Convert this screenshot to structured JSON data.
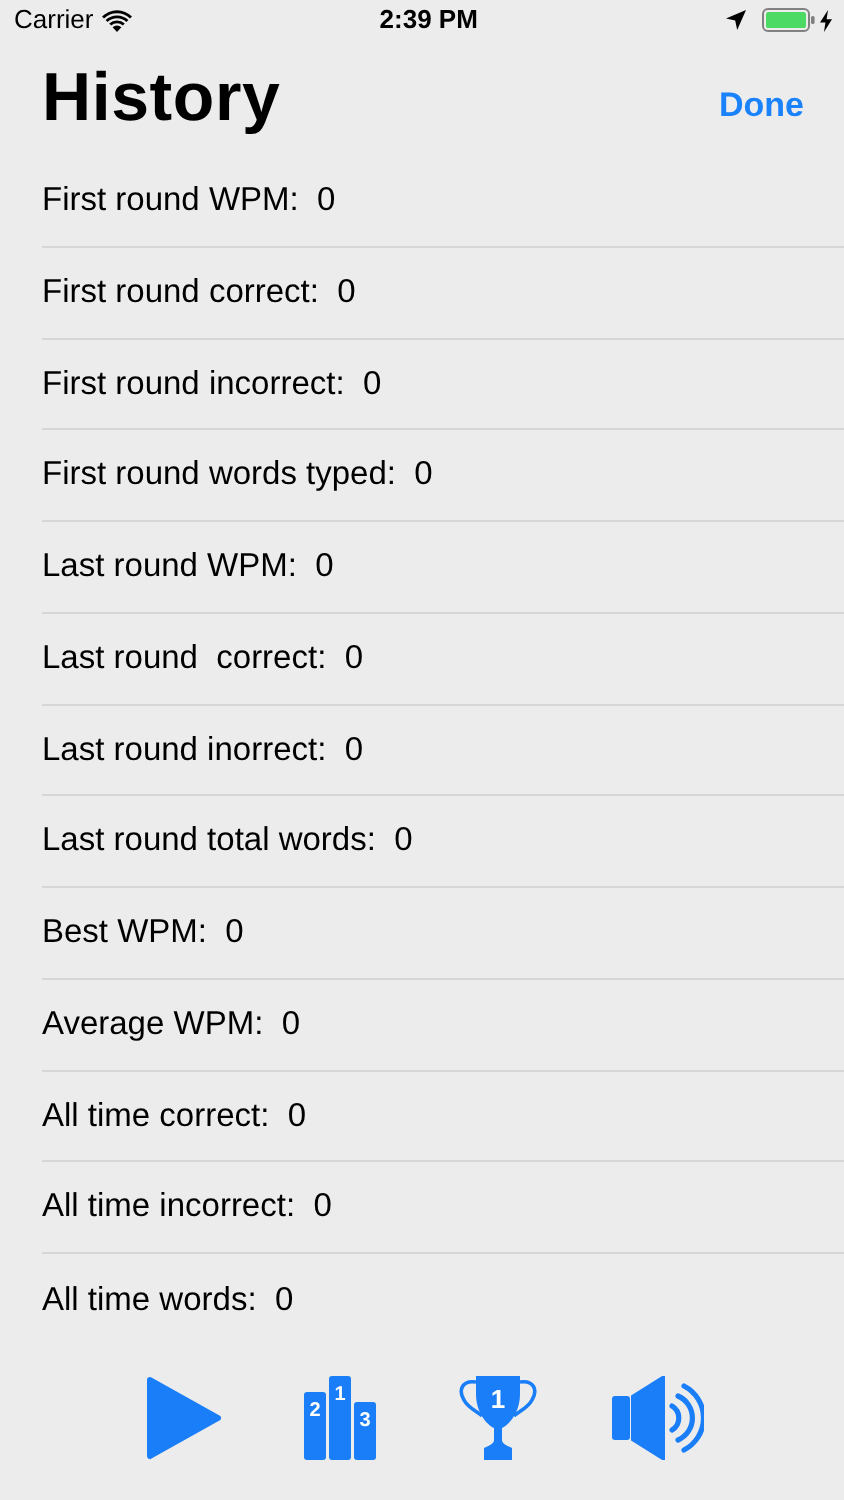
{
  "status_bar": {
    "carrier": "Carrier",
    "time": "2:39 PM"
  },
  "nav": {
    "title": "History",
    "done": "Done"
  },
  "rows": [
    {
      "text": "First round WPM:  0"
    },
    {
      "text": "First round correct:  0"
    },
    {
      "text": "First round incorrect:  0"
    },
    {
      "text": "First round words typed:  0"
    },
    {
      "text": "Last round WPM:  0"
    },
    {
      "text": "Last round  correct:  0"
    },
    {
      "text": "Last round inorrect:  0"
    },
    {
      "text": "Last round total words:  0"
    },
    {
      "text": "Best WPM:  0"
    },
    {
      "text": "Average WPM:  0"
    },
    {
      "text": "All time correct:  0"
    },
    {
      "text": "All time incorrect:  0"
    },
    {
      "text": "All time words:  0"
    }
  ],
  "toolbar": {
    "podium_numbers": [
      "2",
      "1",
      "3"
    ],
    "trophy_number": "1"
  }
}
